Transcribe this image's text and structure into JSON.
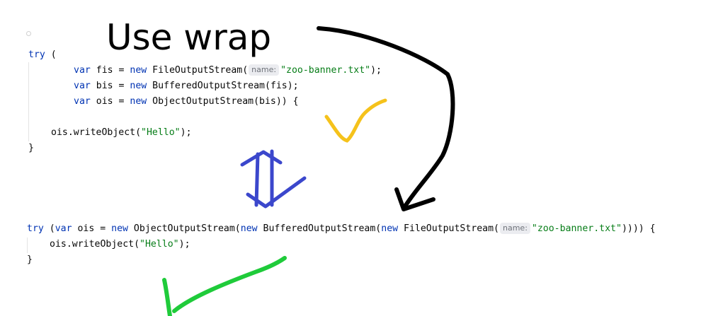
{
  "annotation_text": "Use wrap",
  "code_block_1": {
    "try_kw": "try",
    "open_paren": " (",
    "lines": [
      {
        "kw": "var",
        "name": " fis = ",
        "new_kw": "new",
        "cls": " FileOutputStream(",
        "hint": "name:",
        "str": "\"zoo-banner.txt\"",
        "end": ");"
      },
      {
        "kw": "var",
        "name": " bis = ",
        "new_kw": "new",
        "cls": " BufferedOutputStream(fis);"
      },
      {
        "kw": "var",
        "name": " ois = ",
        "new_kw": "new",
        "cls": " ObjectOutputStream(bis)) {"
      }
    ],
    "body_call": "ois.writeObject(",
    "body_str": "\"Hello\"",
    "body_end": ");",
    "close": "}"
  },
  "code_block_2": {
    "try_kw": "try",
    "p1": " (",
    "var_kw": "var",
    "p2": " ois = ",
    "new1": "new",
    "p3": " ObjectOutputStream(",
    "new2": "new",
    "p4": " BufferedOutputStream(",
    "new3": "new",
    "p5": " FileOutputStream(",
    "hint": "name:",
    "str": "\"zoo-banner.txt\"",
    "end": ")))) {",
    "body_call": "ois.writeObject(",
    "body_str": "\"Hello\"",
    "body_end": ");",
    "close": "}"
  },
  "colors": {
    "arrow_black": "#000000",
    "check_yellow": "#f5c21b",
    "swap_blue": "#3b47cc",
    "check_green": "#1fcb3a"
  }
}
